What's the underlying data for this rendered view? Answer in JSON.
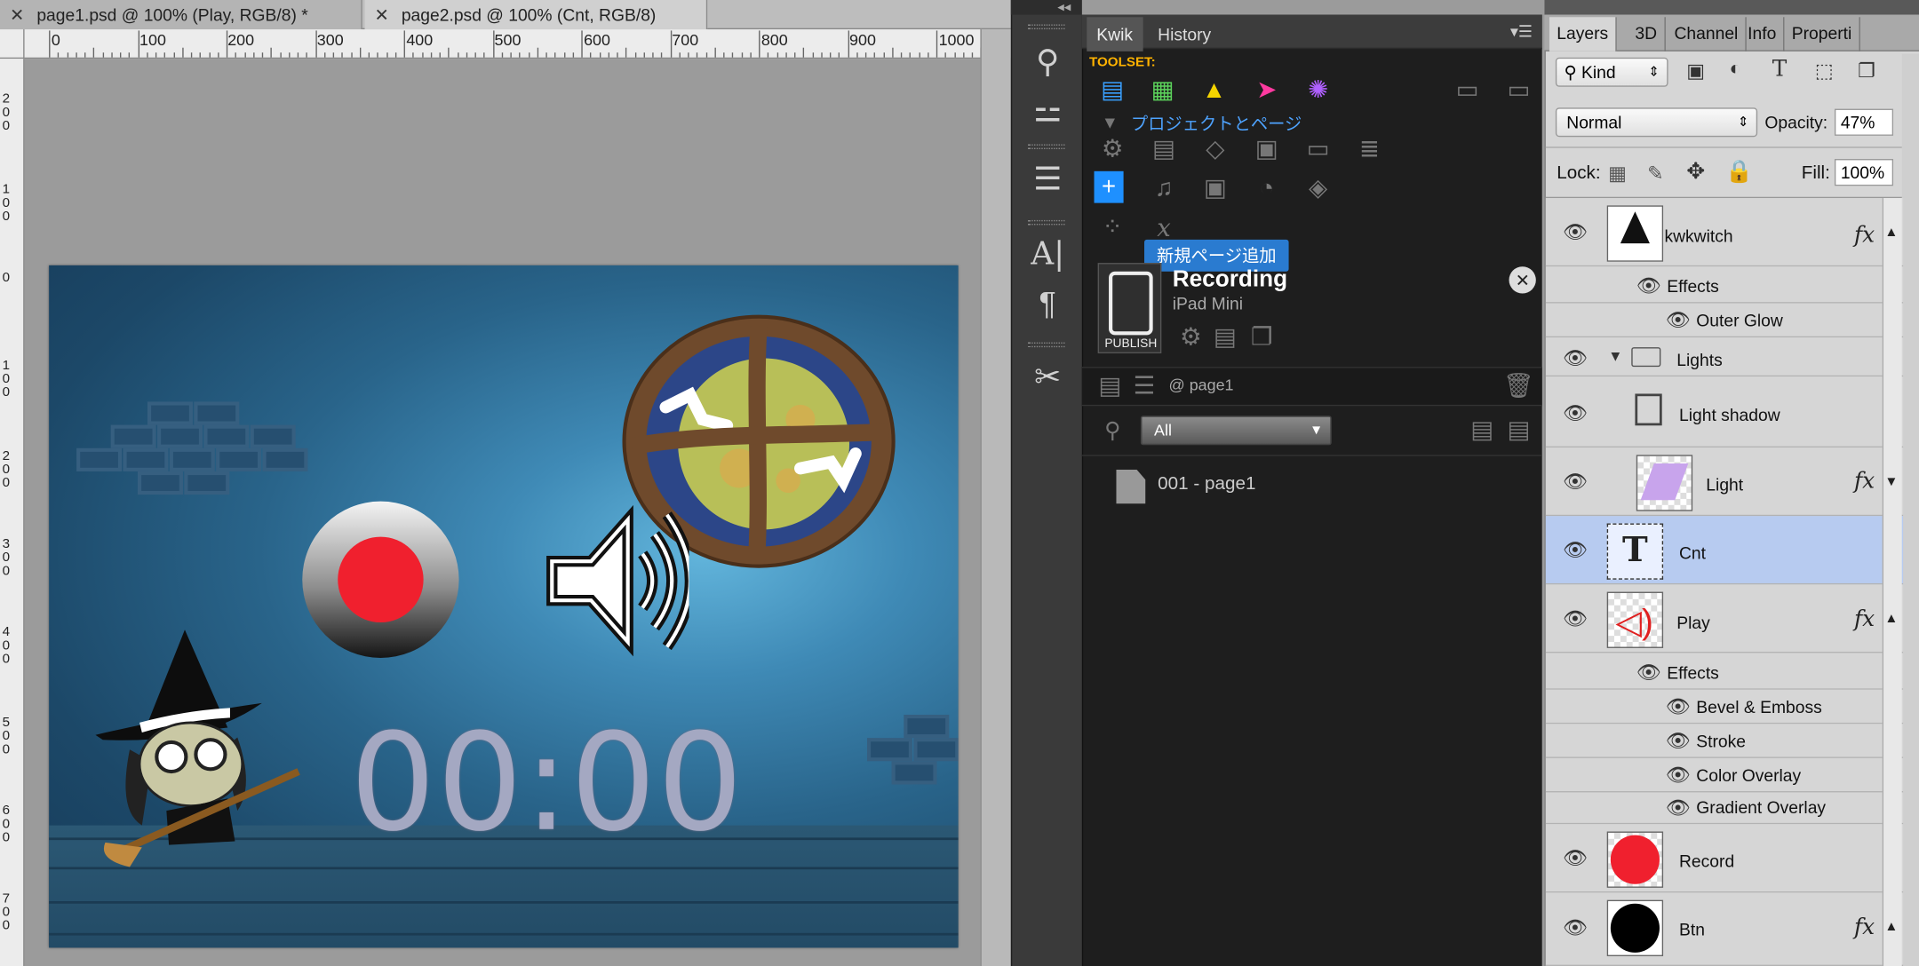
{
  "document_tabs": [
    {
      "label": "page1.psd @ 100% (Play, RGB/8) *"
    },
    {
      "label": "page2.psd @ 100% (Cnt, RGB/8)"
    }
  ],
  "ruler": {
    "h_ticks": [
      "0",
      "100",
      "200",
      "300",
      "400",
      "500",
      "600",
      "700",
      "800",
      "900",
      "1000"
    ],
    "v_ticks": [
      "2\n0\n0",
      "1\n0\n0",
      "0",
      "1\n0\n0",
      "2\n0\n0",
      "3\n0\n0",
      "4\n0\n0",
      "5\n0\n0",
      "6\n0\n0",
      "7\n0\n0"
    ]
  },
  "canvas": {
    "timer_text": "00:00",
    "colors": {
      "sky": "#2a6a92",
      "record_red": "#f0202e",
      "timer": "#a4a8c2"
    }
  },
  "kwik_panel": {
    "tabs": [
      "Kwik",
      "History"
    ],
    "toolset_label": "TOOLSET:",
    "section_label": "プロジェクトとページ",
    "tooltip": "新規ページ追加",
    "project_name": "Recording",
    "device": "iPad Mini",
    "publish_label": "PUBLISH",
    "page_path": "@ page1",
    "filter_value": "All",
    "pages": [
      "001 - page1"
    ]
  },
  "layers_panel": {
    "tabs": [
      "Layers",
      "3D",
      "Channel",
      "Info",
      "Properti"
    ],
    "kind_label": "Kind",
    "blend_mode": "Normal",
    "opacity_label": "Opacity:",
    "opacity_value": "47%",
    "lock_label": "Lock:",
    "fill_label": "Fill:",
    "fill_value": "100%",
    "effects_label": "Effects",
    "layers": [
      {
        "name": "kwkwitch",
        "fx": "fx",
        "effects": [
          "Outer Glow"
        ]
      },
      {
        "name": "Lights"
      },
      {
        "name": "Light shadow"
      },
      {
        "name": "Light",
        "fx": "fx"
      },
      {
        "name": "Cnt",
        "selected": true
      },
      {
        "name": "Play",
        "fx": "fx",
        "effects": [
          "Bevel & Emboss",
          "Stroke",
          "Color Overlay",
          "Gradient Overlay"
        ]
      },
      {
        "name": "Record"
      },
      {
        "name": "Btn",
        "fx": "fx"
      }
    ]
  }
}
